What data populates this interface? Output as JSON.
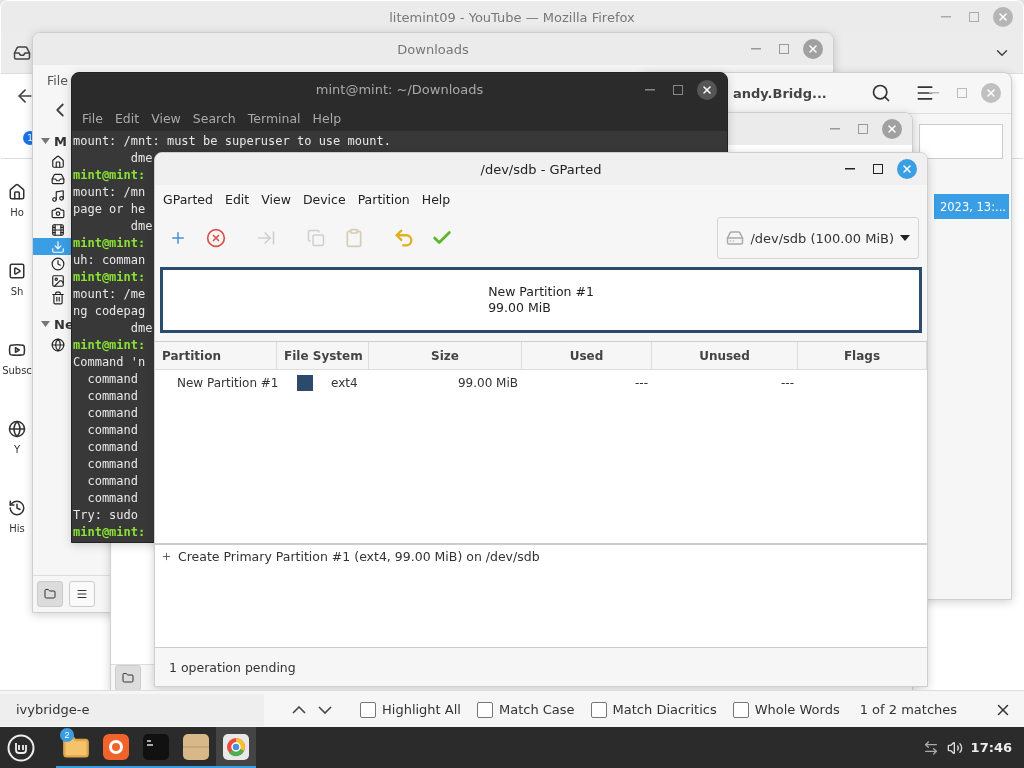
{
  "firefox": {
    "title": "litemint09 - YouTube — Mozilla Firefox",
    "notification_count": "1",
    "sidebar": [
      "Ho",
      "Sh",
      "Subsc",
      "Y",
      "His"
    ]
  },
  "window_a": {
    "title": "andy.Bridg...",
    "date": "2023, 13:..."
  },
  "downloads": {
    "title": "Downloads",
    "menu": [
      "File"
    ],
    "sections": [
      "M",
      "Ne"
    ],
    "places": [
      {
        "selected": false
      },
      {
        "selected": false
      },
      {
        "selected": false
      },
      {
        "selected": false
      },
      {
        "selected": false
      },
      {
        "selected": true
      },
      {
        "selected": false
      },
      {
        "selected": false
      },
      {
        "selected": false
      }
    ]
  },
  "terminal": {
    "title": "mint@mint: ~/Downloads",
    "menu": [
      "File",
      "Edit",
      "View",
      "Search",
      "Terminal",
      "Help"
    ],
    "lines": [
      {
        "kind": "output",
        "text": "mount: /mnt: must be superuser to use mount."
      },
      {
        "kind": "output",
        "text": "        dme"
      },
      {
        "kind": "prompt",
        "text": "mint@mint:"
      },
      {
        "kind": "output",
        "text": "mount: /mn"
      },
      {
        "kind": "output",
        "text": "page or he"
      },
      {
        "kind": "output",
        "text": "        dme"
      },
      {
        "kind": "prompt",
        "text": "mint@mint:"
      },
      {
        "kind": "output",
        "text": "uh: comman"
      },
      {
        "kind": "prompt",
        "text": "mint@mint:"
      },
      {
        "kind": "output",
        "text": "mount: /me"
      },
      {
        "kind": "output",
        "text": "ng codepag"
      },
      {
        "kind": "output",
        "text": "        dme"
      },
      {
        "kind": "prompt",
        "text": "mint@mint:"
      },
      {
        "kind": "output",
        "text": "Command 'n"
      },
      {
        "kind": "output",
        "text": "  command"
      },
      {
        "kind": "output",
        "text": "  command"
      },
      {
        "kind": "output",
        "text": "  command"
      },
      {
        "kind": "output",
        "text": "  command"
      },
      {
        "kind": "output",
        "text": "  command"
      },
      {
        "kind": "output",
        "text": "  command"
      },
      {
        "kind": "output",
        "text": "  command"
      },
      {
        "kind": "output",
        "text": "  command"
      },
      {
        "kind": "output",
        "text": "Try: sudo"
      },
      {
        "kind": "prompt",
        "text": "mint@mint:"
      }
    ]
  },
  "gparted": {
    "title": "/dev/sdb - GParted",
    "menu": [
      "GParted",
      "Edit",
      "View",
      "Device",
      "Partition",
      "Help"
    ],
    "toolbar": [
      {
        "kind": "new",
        "disabled": false
      },
      {
        "kind": "delete",
        "disabled": false
      },
      {
        "kind": "resize",
        "disabled": true
      },
      {
        "kind": "copy",
        "disabled": true
      },
      {
        "kind": "paste",
        "disabled": true
      },
      {
        "kind": "undo",
        "disabled": false
      },
      {
        "kind": "apply",
        "disabled": false
      }
    ],
    "device": "/dev/sdb (100.00 MiB)",
    "map": {
      "name": "New Partition #1",
      "size": "99.00 MiB",
      "color": "#2c4a6b"
    },
    "columns": [
      "Partition",
      "File System",
      "Size",
      "Used",
      "Unused",
      "Flags"
    ],
    "rows": [
      {
        "partition": "New Partition #1",
        "color": "#2c4a6b",
        "file_system": "ext4",
        "size": "99.00 MiB",
        "used": "---",
        "unused": "---"
      }
    ],
    "operations": [
      "Create Primary Partition #1 (ext4, 99.00 MiB) on /dev/sdb"
    ],
    "status": "1 operation pending"
  },
  "find_bar": {
    "value": "ivybridge-e",
    "options": [
      {
        "label": "Highlight All",
        "checked": false
      },
      {
        "label": "Match Case",
        "checked": false
      },
      {
        "label": "Match Diacritics",
        "checked": false
      },
      {
        "label": "Whole Words",
        "checked": false
      }
    ],
    "matches": "1 of 2 matches"
  },
  "taskbar": {
    "badge": "2",
    "apps": [
      {
        "kind": "files",
        "active": false
      },
      {
        "kind": "firefox",
        "active": false
      },
      {
        "kind": "terminal",
        "active": false
      },
      {
        "kind": "archive",
        "active": false
      },
      {
        "kind": "gparted",
        "active": true
      }
    ],
    "clock": "17:46"
  }
}
